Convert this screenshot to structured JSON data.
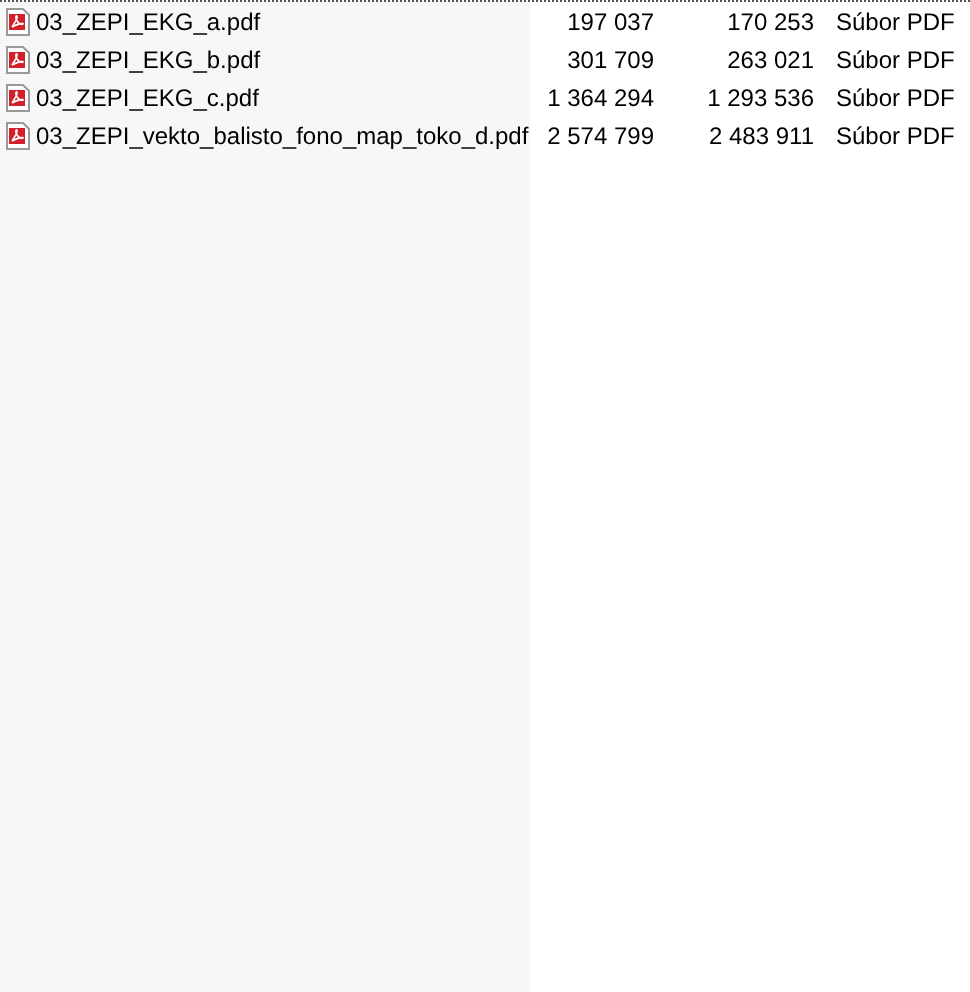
{
  "files": [
    {
      "name": "03_ZEPI_EKG_a.pdf",
      "column_2": "197 037",
      "column_3": "170 253",
      "type": "Súbor PDF"
    },
    {
      "name": "03_ZEPI_EKG_b.pdf",
      "column_2": "301 709",
      "column_3": "263 021",
      "type": "Súbor PDF"
    },
    {
      "name": "03_ZEPI_EKG_c.pdf",
      "column_2": "1 364 294",
      "column_3": "1 293 536",
      "type": "Súbor PDF"
    },
    {
      "name": "03_ZEPI_vekto_balisto_fono_map_toko_d.pdf",
      "column_2": "2 574 799",
      "column_3": "2 483 911",
      "type": "Súbor PDF"
    }
  ]
}
